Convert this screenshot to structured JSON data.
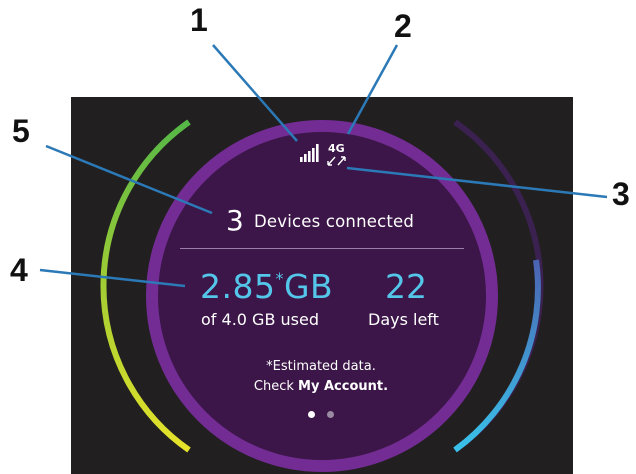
{
  "colors": {
    "background": "#221f20",
    "ring": "#722c93",
    "inner": "#3c1648",
    "highlight": "#54c6ea",
    "leader_line": "#2b79b6"
  },
  "icons": {
    "signal": "signal-bars-icon",
    "data_transfer": "data-transfer-arrows-icon"
  },
  "callouts": [
    "1",
    "2",
    "3",
    "4",
    "5"
  ],
  "status_bar": {
    "network_type": "4G"
  },
  "devices": {
    "count": "3",
    "label": "Devices connected"
  },
  "data_usage": {
    "used_value": "2.85",
    "estimate_mark": "*",
    "used_unit": "GB",
    "of_text": "of 4.0 GB used",
    "used_fraction": 0.7125
  },
  "billing": {
    "days_value": "22",
    "days_label": "Days left"
  },
  "footnote": {
    "estimate_mark": "*",
    "estimate_text": "Estimated data.",
    "check_text": "Check ",
    "account_link": "My Account."
  },
  "pager": {
    "pages": 2,
    "active_page": 1
  }
}
